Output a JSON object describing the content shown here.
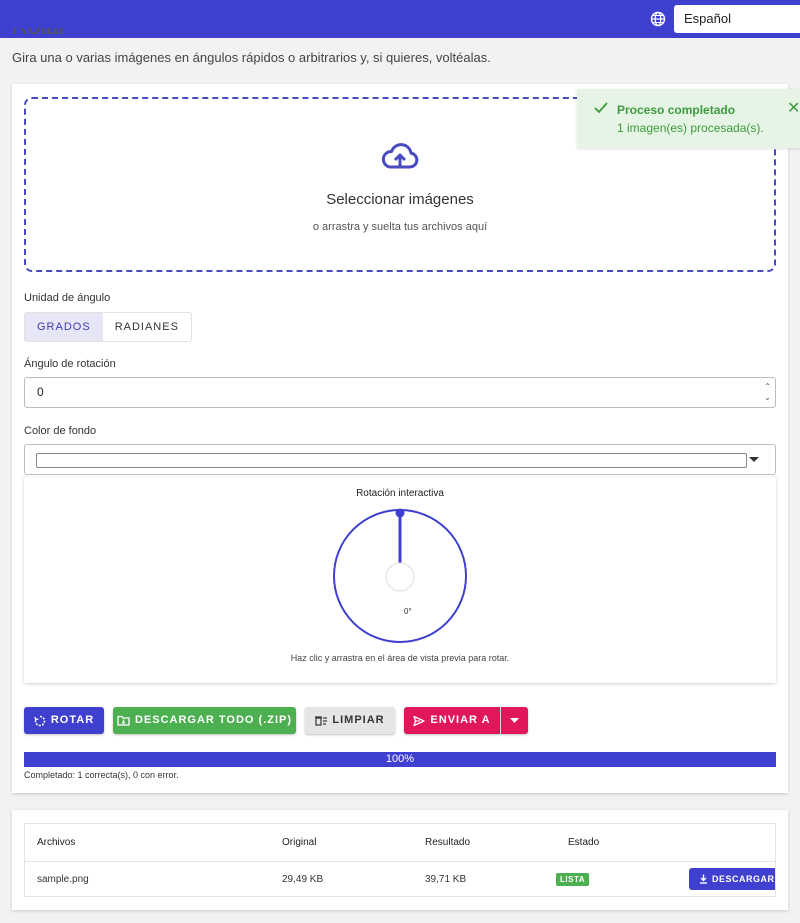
{
  "header": {
    "title": "Rotar imágenes",
    "language": "Español"
  },
  "subtitle": "Gira una o varias imágenes en ángulos rápidos o arbitrarios y, si quieres, voltéalas.",
  "dropzone": {
    "title": "Seleccionar imágenes",
    "subtitle": "o arrastra y suelta tus archivos aquí"
  },
  "angle_unit": {
    "label": "Unidad de ángulo",
    "options": [
      "GRADOS",
      "RADIANES"
    ],
    "selected": "GRADOS"
  },
  "rotation": {
    "label": "Ángulo de rotación",
    "value": "0"
  },
  "background": {
    "label": "Color de fondo"
  },
  "preview": {
    "title": "Rotación interactiva",
    "angle_display": "0°",
    "hint": "Haz clic y arrastra en el área de vista previa para rotar."
  },
  "actions": {
    "rotate": "ROTAR",
    "download_all": "DESCARGAR TODO (.ZIP)",
    "clear": "LIMPIAR",
    "send_to": "ENVIAR A"
  },
  "progress": {
    "percent": 100,
    "label": "100%",
    "status": "Completado: 1 correcta(s), 0 con error."
  },
  "table": {
    "headers": [
      "Archivos",
      "Original",
      "Resultado",
      "Estado"
    ],
    "rows": [
      {
        "file": "sample.png",
        "original": "29,49 KB",
        "result": "39,71 KB",
        "status": "LISTA",
        "action": "DESCARGAR"
      }
    ]
  },
  "toast": {
    "title": "Proceso completado",
    "message": "1 imagen(es) procesada(s)."
  },
  "colors": {
    "primary": "#4040d0",
    "success": "#4caf50",
    "accent": "#e0175c",
    "toast_bg": "#e6f4e6"
  }
}
